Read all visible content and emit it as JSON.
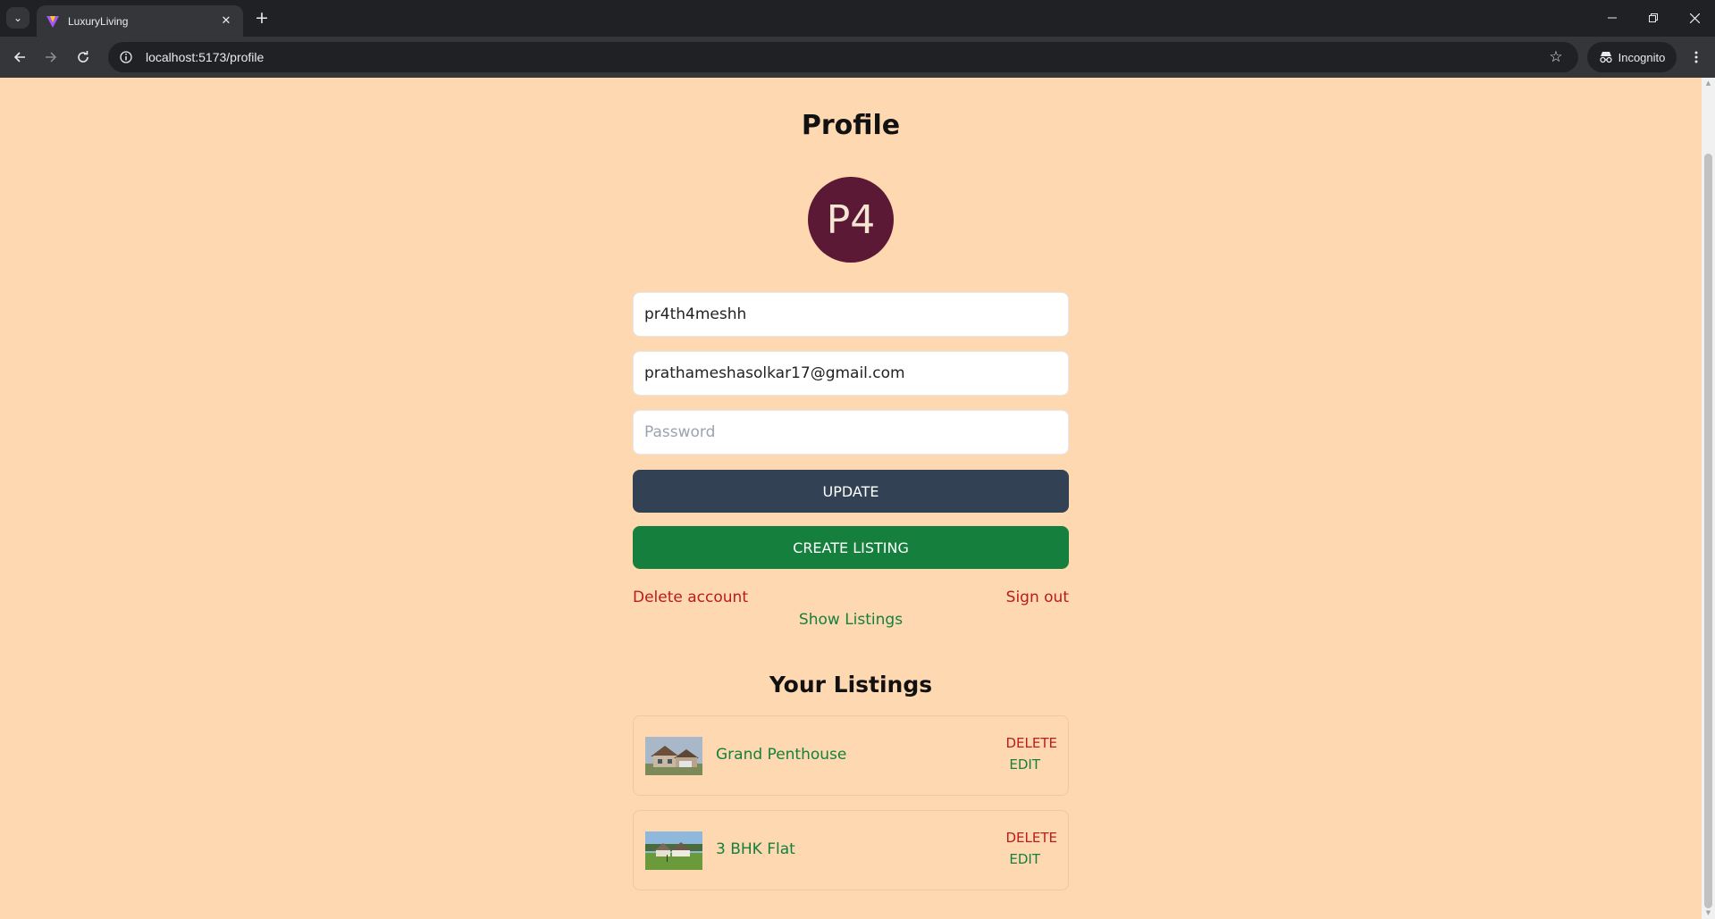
{
  "browser": {
    "tab_title": "LuxuryLiving",
    "url": "localhost:5173/profile",
    "incognito_label": "Incognito"
  },
  "page": {
    "title": "Profile",
    "avatar_initials": "P4",
    "username_value": "pr4th4meshh",
    "email_value": "prathameshasolkar17@gmail.com",
    "password_placeholder": "Password",
    "update_label": "UPDATE",
    "create_listing_label": "CREATE LISTING",
    "delete_account_label": "Delete account",
    "sign_out_label": "Sign out",
    "show_listings_label": "Show Listings",
    "listings_title": "Your Listings",
    "listings": [
      {
        "name": "Grand Penthouse",
        "delete_label": "DELETE",
        "edit_label": "EDIT",
        "thumb": "house-icon"
      },
      {
        "name": "3 BHK Flat",
        "delete_label": "DELETE",
        "edit_label": "EDIT",
        "thumb": "house-icon"
      }
    ]
  },
  "colors": {
    "page_bg": "#fed8b1",
    "avatar_bg": "#5c1935",
    "update_bg": "#334155",
    "create_bg": "#15803d",
    "danger": "#b91c1c",
    "success": "#15803d"
  }
}
